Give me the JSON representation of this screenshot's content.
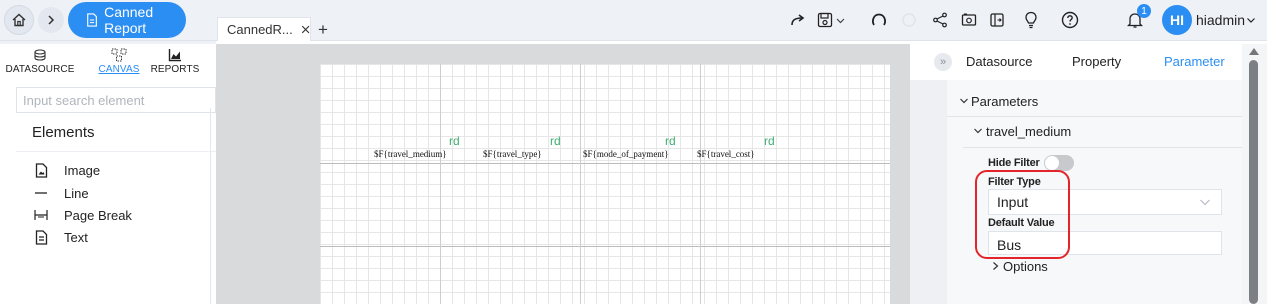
{
  "header": {
    "report_title": "Canned Report",
    "doc_tab_label": "CannedR...",
    "notification_count": "1",
    "avatar_initials": "HI",
    "username": "hiadmin"
  },
  "left_panel": {
    "tabs": [
      {
        "label": "DATASOURCE",
        "icon": "database-icon"
      },
      {
        "label": "CANVAS",
        "icon": "canvas-icon"
      },
      {
        "label": "REPORTS",
        "icon": "chart-icon"
      }
    ],
    "search_placeholder": "Input search element",
    "elements_title": "Elements",
    "elements": [
      {
        "label": "Image",
        "icon": "image-icon"
      },
      {
        "label": "Line",
        "icon": "line-icon"
      },
      {
        "label": "Page Break",
        "icon": "page-break-icon"
      },
      {
        "label": "Text",
        "icon": "text-icon"
      }
    ]
  },
  "canvas": {
    "fields": [
      "$F{travel_medium}",
      "$F{travel_type}",
      "$F{mode_of_payment}",
      "$F{travel_cost}"
    ],
    "field_markers": [
      "rd",
      "rd",
      "rd",
      "rd"
    ]
  },
  "right_panel": {
    "tabs": [
      "Datasource",
      "Property",
      "Parameter"
    ],
    "active_tab": "Parameter",
    "parameters_label": "Parameters",
    "parameter_name": "travel_medium",
    "hide_filter_label": "Hide Filter",
    "filter_type_label": "Filter Type",
    "filter_type_value": "Input",
    "default_value_label": "Default Value",
    "default_value": "Bus",
    "options_label": "Options"
  },
  "colors": {
    "accent": "#2b8ef3",
    "highlight": "#e3252b",
    "marker_green": "#3fae72"
  }
}
